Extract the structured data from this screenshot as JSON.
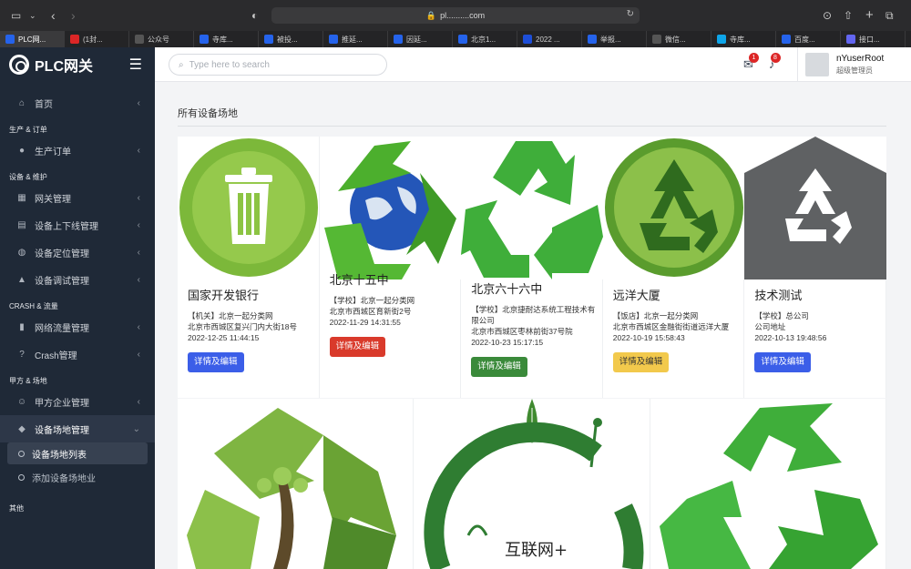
{
  "browser": {
    "url": "pl..........com",
    "tabs": [
      {
        "label": "PLC网...",
        "color": "#2563eb",
        "active": true
      },
      {
        "label": "(1封...",
        "color": "#dc2626",
        "active": false
      },
      {
        "label": "公众号",
        "color": "#555555",
        "active": false
      },
      {
        "label": "寺库...",
        "color": "#2563eb",
        "active": false
      },
      {
        "label": "被投...",
        "color": "#2563eb",
        "active": false
      },
      {
        "label": "推延...",
        "color": "#2563eb",
        "active": false
      },
      {
        "label": "因延...",
        "color": "#2563eb",
        "active": false
      },
      {
        "label": "北京1...",
        "color": "#2563eb",
        "active": false
      },
      {
        "label": "2022 ...",
        "color": "#1d4ed8",
        "active": false
      },
      {
        "label": "举报...",
        "color": "#2563eb",
        "active": false
      },
      {
        "label": "微信...",
        "color": "#555555",
        "active": false
      },
      {
        "label": "寺库...",
        "color": "#0ea5e9",
        "active": false
      },
      {
        "label": "百度...",
        "color": "#2563eb",
        "active": false
      },
      {
        "label": "接口...",
        "color": "#6366f1",
        "active": false
      }
    ]
  },
  "sidebar": {
    "brand": "PLC网关",
    "home": "首页",
    "groups": [
      {
        "title": "生产 & 订单",
        "items": [
          {
            "label": "生产订单",
            "icon": "drop-icon"
          }
        ]
      },
      {
        "title": "设备 & 维护",
        "items": [
          {
            "label": "网关管理",
            "icon": "grid-icon"
          },
          {
            "label": "设备上下线管理",
            "icon": "file-icon"
          },
          {
            "label": "设备定位管理",
            "icon": "user-pin-icon"
          },
          {
            "label": "设备调试管理",
            "icon": "warning-icon"
          }
        ]
      },
      {
        "title": "CRASH & 流量",
        "items": [
          {
            "label": "网络流量管理",
            "icon": "bar-chart-icon"
          },
          {
            "label": "Crash管理",
            "icon": "question-icon"
          }
        ]
      },
      {
        "title": "甲方 & 场地",
        "items": [
          {
            "label": "甲方企业管理",
            "icon": "users-icon"
          },
          {
            "label": "设备场地管理",
            "icon": "tag-icon"
          }
        ]
      }
    ],
    "sub_items": [
      "设备场地列表",
      "添加设备场地业"
    ],
    "other_group": "其他"
  },
  "topbar": {
    "search_placeholder": "Type here to search",
    "messages_count": "1",
    "notifications_count": "8",
    "user_name": "nYuserRoot",
    "user_role": "超级管理员"
  },
  "main": {
    "title": "所有设备场地",
    "cards": [
      {
        "title": "国家开发银行",
        "lines": [
          "【机关】北京一起分类网",
          "北京市西城区复兴门内大街18号",
          "2022-12-25 11:44:15"
        ],
        "button": "详情及编辑",
        "btn_color": "#3b5ee8"
      },
      {
        "title": "北京十五中",
        "lines": [
          "【学校】北京一起分类网",
          "北京市西城区育新街2号",
          "2022-11-29 14:31:55"
        ],
        "button": "详情及编辑",
        "btn_color": "#d93a2b"
      },
      {
        "title": "北京六十六中",
        "lines": [
          "【学校】北京捷耐达系统工程技术有限公司",
          "北京市西城区枣林前街37号院",
          "2022-10-23 15:17:15"
        ],
        "button": "详情及编辑",
        "btn_color": "#3a8a3a"
      },
      {
        "title": "远洋大厦",
        "lines": [
          "【饭店】北京一起分类网",
          "北京市西城区金融街街道远洋大厦",
          "2022-10-19 15:58:43"
        ],
        "button": "详情及编辑",
        "btn_color": "#f2c94c"
      },
      {
        "title": "技术测试",
        "lines": [
          "【学校】总公司",
          "公司地址",
          "2022-10-13 19:48:56"
        ],
        "button": "详情及编辑",
        "btn_color": "#3b5ee8"
      }
    ],
    "row2_text": "互联网+"
  }
}
